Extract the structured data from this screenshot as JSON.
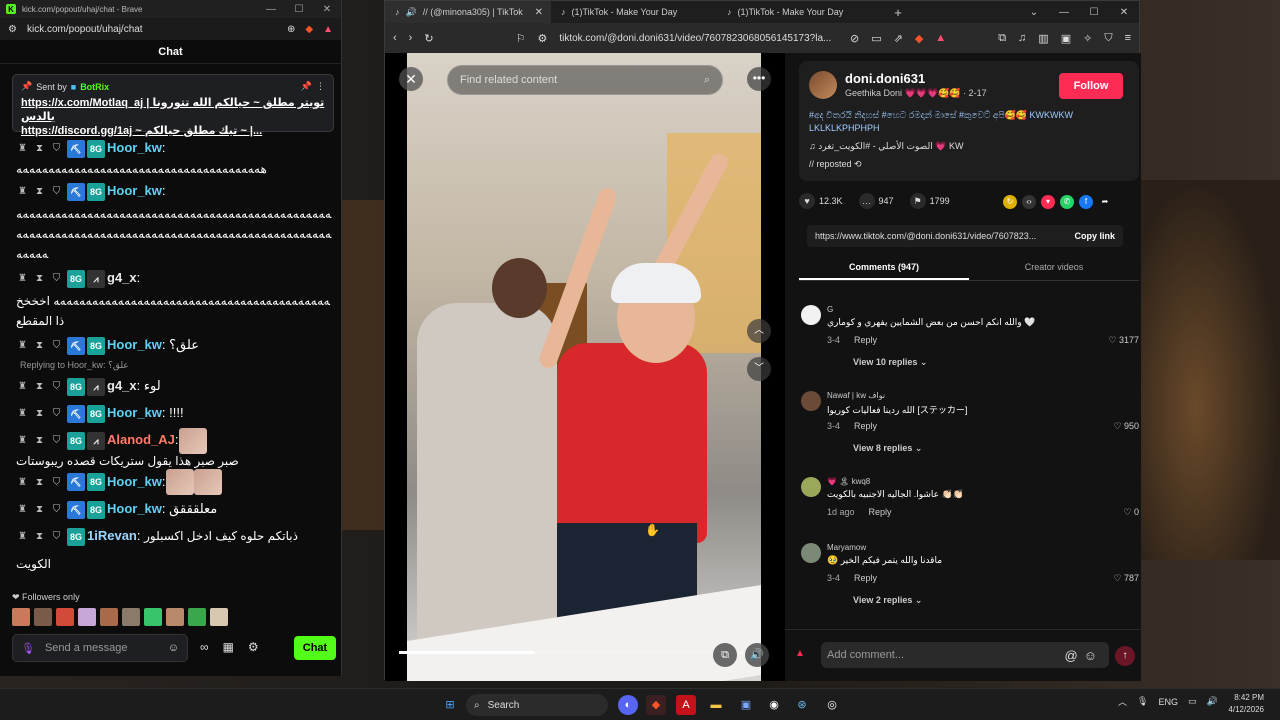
{
  "left_window": {
    "title": "kick.com/popout/uhaj/chat - Brave",
    "url": "kick.com/popout/uhaj/chat",
    "chat_header": "Chat",
    "pinned": {
      "sent_by_label": "Sent by",
      "sender": "BotRix",
      "line1": "https://x.com/Motlaq_aj | تويتر مطلق ~ حيالكم الله تتورونا بالدس",
      "line2": "https://discord.gg/1aj ~ تيك مطلق حيالكم ~ |..."
    },
    "messages": [
      {
        "user": "Hoor_kw",
        "sep": ":",
        "text": "ﻫﻪﻪﻪﻪﻪﻪﻪﻪﻪﻪﻪﻪﻪﻪﻪﻪﻪﻪﻪﻪﻪﻪﻪﻪﻪﻪﻪﻪﻪﻪﻪﻪﻪﻪﻪﻪﻪﻪ",
        "color": "#5fd3f3"
      },
      {
        "user": "Hoor_kw",
        "sep": ":",
        "text": "ﻪﻪﻪﻪﻪﻪﻪﻪﻪﻪﻪﻪﻪﻪﻪﻪﻪﻪﻪﻪﻪﻪﻪﻪﻪﻪﻪﻪﻪﻪﻪﻪﻪﻪﻪﻪﻪﻪﻪﻪﻪﻪﻪﻪﻪﻪﻪﻪﻪﻪﻪﻪﻪﻪﻪﻪﻪﻪﻪﻪﻪﻪﻪﻪﻪﻪﻪﻪﻪﻪﻪﻪﻪﻪﻪﻪﻪﻪﻪﻪﻪﻪﻪﻪﻪﻪﻪﻪﻪﻪﻪﻪﻪﻪﻪﻪﻪﻪﻪﻪﻪﻪﻪ",
        "color": "#5fd3f3"
      },
      {
        "user": "g4_x",
        "sep": ":",
        "text": "ﻪﻪﻪﻪﻪﻪﻪﻪﻪﻪﻪﻪﻪﻪﻪﻪﻪﻪﻪﻪﻪﻪﻪﻪﻪﻪﻪﻪﻪﻪﻪﻪﻪﻪﻪﻪﻪﻪﻪﻪﻪﻪﻪ اخخخخ ذا المقطع",
        "color": "#e9e9e9"
      },
      {
        "user": "Hoor_kw",
        "sep": ":",
        "text": "علق؟",
        "color": "#5fd3f3"
      }
    ],
    "reply_note": "Replying to Hoor_kw: علق؟",
    "messages2": [
      {
        "user": "g4_x",
        "sep": ":",
        "text": "لوء",
        "color": "#e9e9e9"
      },
      {
        "user": "Hoor_kw",
        "sep": ":",
        "text": "!!!!",
        "color": "#5fd3f3"
      },
      {
        "user": "Alanod_AJ",
        "sep": ":",
        "text": "صبر صبر هذا يقول ستريكات قصده ريبوستات",
        "color": "#ff7b6b"
      },
      {
        "user": "Hoor_kw",
        "sep": ":",
        "text": "",
        "color": "#5fd3f3"
      },
      {
        "user": "Hoor_kw",
        "sep": ":",
        "text": "معلقققق",
        "color": "#5fd3f3"
      },
      {
        "user": "1iRevan",
        "sep": ":",
        "text": "ذباتكم حلوه كيف ادخل اكسبلور الكويت",
        "color": "#9ad7ff"
      }
    ],
    "followers_only": "Followers only",
    "input_placeholder": "Send a message",
    "chat_button": "Chat"
  },
  "right_window": {
    "tabs": [
      {
        "label": "// (@minona305) | TikTok"
      },
      {
        "label": "(1)TikTok - Make Your Day"
      },
      {
        "label": "(1)TikTok - Make Your Day"
      }
    ],
    "url": "tiktok.com/@doni.doni631/video/7607823068056145173?la...",
    "video": {
      "search_placeholder": "Find related content",
      "progress": 0.38
    },
    "post": {
      "handle": "doni.doni631",
      "display_name": "Geethika Doni 💗💗💗🥰🥰 · 2-17",
      "follow_label": "Follow",
      "caption": "#අද විතරයි නිදහස් #හෙට රමදාන් මාසේ #කුවෙට් අපි🥰🥰 KWKWKW LKLKLKPHPHPH",
      "music": "♫ الصوت الأصلي - #الكويت_تغرد 💗 KW",
      "reposted": "// reposted",
      "likes": "12.3K",
      "comments_count": "947",
      "saves": "1799",
      "link": "https://www.tiktok.com/@doni.doni631/video/7607823...",
      "copy_link": "Copy link"
    },
    "comment_tabs": {
      "comments": "Comments (947)",
      "creator": "Creator videos"
    },
    "comments": [
      {
        "user": "G",
        "text": "والله انكم احسن من بعض الشمايين يفهري و كوماري 🤍",
        "date": "3-4",
        "reply": "Reply",
        "likes": "3177",
        "view_replies": "View 10 replies ⌄",
        "avatar": "#f2f2f2"
      },
      {
        "user": "Nawaf | kw نواف",
        "text": "الله ردينا فعاليات كوريوا [ステッカー]",
        "date": "3-4",
        "reply": "Reply",
        "likes": "950",
        "view_replies": "View 8 replies ⌄",
        "avatar": "#6b4a38"
      },
      {
        "user": "💗 🏝 kwq8",
        "text": "عاشوا. الجاليه الاجنبيه بالكويت 👏🏻👏🏻",
        "date": "1d ago",
        "reply": "Reply",
        "likes": "0",
        "view_replies": "",
        "avatar": "#9aa85a"
      },
      {
        "user": "Maryamow",
        "text": "🥹 ماقدنا والله يتمر فيكم الخير",
        "date": "3-4",
        "reply": "Reply",
        "likes": "787",
        "view_replies": "View 2 replies ⌄",
        "avatar": "#7b8a76"
      }
    ],
    "add_comment": "Add comment..."
  },
  "taskbar": {
    "search": "Search",
    "lang": "ENG",
    "time": "8:42 PM",
    "date": "4/12/2026"
  }
}
